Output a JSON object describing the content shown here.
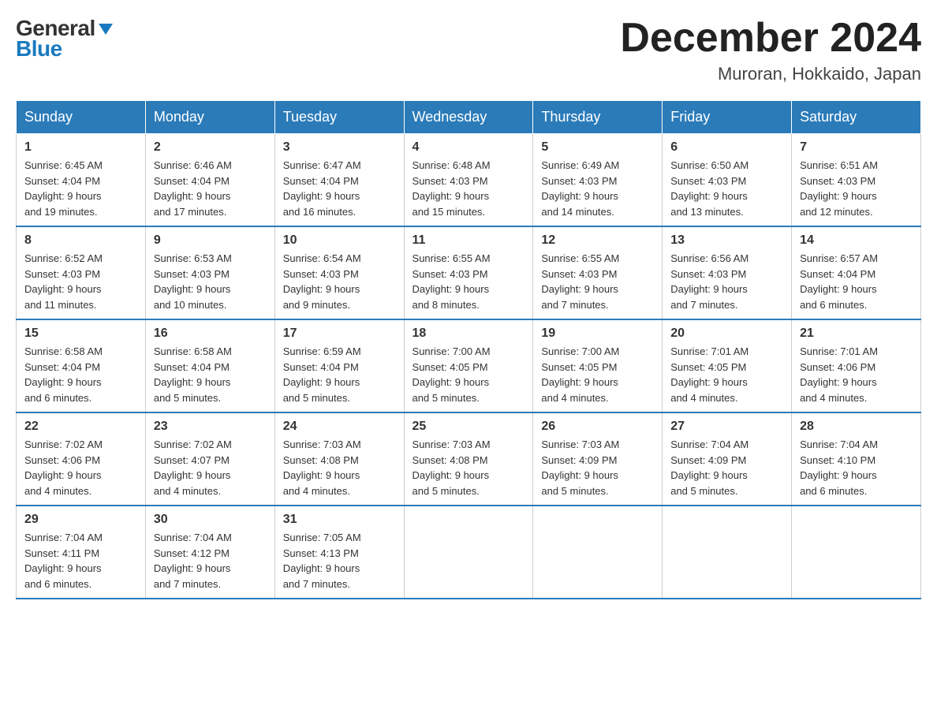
{
  "logo": {
    "general": "General",
    "blue": "Blue"
  },
  "title": "December 2024",
  "location": "Muroran, Hokkaido, Japan",
  "days_of_week": [
    "Sunday",
    "Monday",
    "Tuesday",
    "Wednesday",
    "Thursday",
    "Friday",
    "Saturday"
  ],
  "weeks": [
    [
      {
        "day": "1",
        "sunrise": "6:45 AM",
        "sunset": "4:04 PM",
        "daylight": "9 hours and 19 minutes."
      },
      {
        "day": "2",
        "sunrise": "6:46 AM",
        "sunset": "4:04 PM",
        "daylight": "9 hours and 17 minutes."
      },
      {
        "day": "3",
        "sunrise": "6:47 AM",
        "sunset": "4:04 PM",
        "daylight": "9 hours and 16 minutes."
      },
      {
        "day": "4",
        "sunrise": "6:48 AM",
        "sunset": "4:03 PM",
        "daylight": "9 hours and 15 minutes."
      },
      {
        "day": "5",
        "sunrise": "6:49 AM",
        "sunset": "4:03 PM",
        "daylight": "9 hours and 14 minutes."
      },
      {
        "day": "6",
        "sunrise": "6:50 AM",
        "sunset": "4:03 PM",
        "daylight": "9 hours and 13 minutes."
      },
      {
        "day": "7",
        "sunrise": "6:51 AM",
        "sunset": "4:03 PM",
        "daylight": "9 hours and 12 minutes."
      }
    ],
    [
      {
        "day": "8",
        "sunrise": "6:52 AM",
        "sunset": "4:03 PM",
        "daylight": "9 hours and 11 minutes."
      },
      {
        "day": "9",
        "sunrise": "6:53 AM",
        "sunset": "4:03 PM",
        "daylight": "9 hours and 10 minutes."
      },
      {
        "day": "10",
        "sunrise": "6:54 AM",
        "sunset": "4:03 PM",
        "daylight": "9 hours and 9 minutes."
      },
      {
        "day": "11",
        "sunrise": "6:55 AM",
        "sunset": "4:03 PM",
        "daylight": "9 hours and 8 minutes."
      },
      {
        "day": "12",
        "sunrise": "6:55 AM",
        "sunset": "4:03 PM",
        "daylight": "9 hours and 7 minutes."
      },
      {
        "day": "13",
        "sunrise": "6:56 AM",
        "sunset": "4:03 PM",
        "daylight": "9 hours and 7 minutes."
      },
      {
        "day": "14",
        "sunrise": "6:57 AM",
        "sunset": "4:04 PM",
        "daylight": "9 hours and 6 minutes."
      }
    ],
    [
      {
        "day": "15",
        "sunrise": "6:58 AM",
        "sunset": "4:04 PM",
        "daylight": "9 hours and 6 minutes."
      },
      {
        "day": "16",
        "sunrise": "6:58 AM",
        "sunset": "4:04 PM",
        "daylight": "9 hours and 5 minutes."
      },
      {
        "day": "17",
        "sunrise": "6:59 AM",
        "sunset": "4:04 PM",
        "daylight": "9 hours and 5 minutes."
      },
      {
        "day": "18",
        "sunrise": "7:00 AM",
        "sunset": "4:05 PM",
        "daylight": "9 hours and 5 minutes."
      },
      {
        "day": "19",
        "sunrise": "7:00 AM",
        "sunset": "4:05 PM",
        "daylight": "9 hours and 4 minutes."
      },
      {
        "day": "20",
        "sunrise": "7:01 AM",
        "sunset": "4:05 PM",
        "daylight": "9 hours and 4 minutes."
      },
      {
        "day": "21",
        "sunrise": "7:01 AM",
        "sunset": "4:06 PM",
        "daylight": "9 hours and 4 minutes."
      }
    ],
    [
      {
        "day": "22",
        "sunrise": "7:02 AM",
        "sunset": "4:06 PM",
        "daylight": "9 hours and 4 minutes."
      },
      {
        "day": "23",
        "sunrise": "7:02 AM",
        "sunset": "4:07 PM",
        "daylight": "9 hours and 4 minutes."
      },
      {
        "day": "24",
        "sunrise": "7:03 AM",
        "sunset": "4:08 PM",
        "daylight": "9 hours and 4 minutes."
      },
      {
        "day": "25",
        "sunrise": "7:03 AM",
        "sunset": "4:08 PM",
        "daylight": "9 hours and 5 minutes."
      },
      {
        "day": "26",
        "sunrise": "7:03 AM",
        "sunset": "4:09 PM",
        "daylight": "9 hours and 5 minutes."
      },
      {
        "day": "27",
        "sunrise": "7:04 AM",
        "sunset": "4:09 PM",
        "daylight": "9 hours and 5 minutes."
      },
      {
        "day": "28",
        "sunrise": "7:04 AM",
        "sunset": "4:10 PM",
        "daylight": "9 hours and 6 minutes."
      }
    ],
    [
      {
        "day": "29",
        "sunrise": "7:04 AM",
        "sunset": "4:11 PM",
        "daylight": "9 hours and 6 minutes."
      },
      {
        "day": "30",
        "sunrise": "7:04 AM",
        "sunset": "4:12 PM",
        "daylight": "9 hours and 7 minutes."
      },
      {
        "day": "31",
        "sunrise": "7:05 AM",
        "sunset": "4:13 PM",
        "daylight": "9 hours and 7 minutes."
      },
      null,
      null,
      null,
      null
    ]
  ],
  "labels": {
    "sunrise_prefix": "Sunrise: ",
    "sunset_prefix": "Sunset: ",
    "daylight_prefix": "Daylight: "
  }
}
